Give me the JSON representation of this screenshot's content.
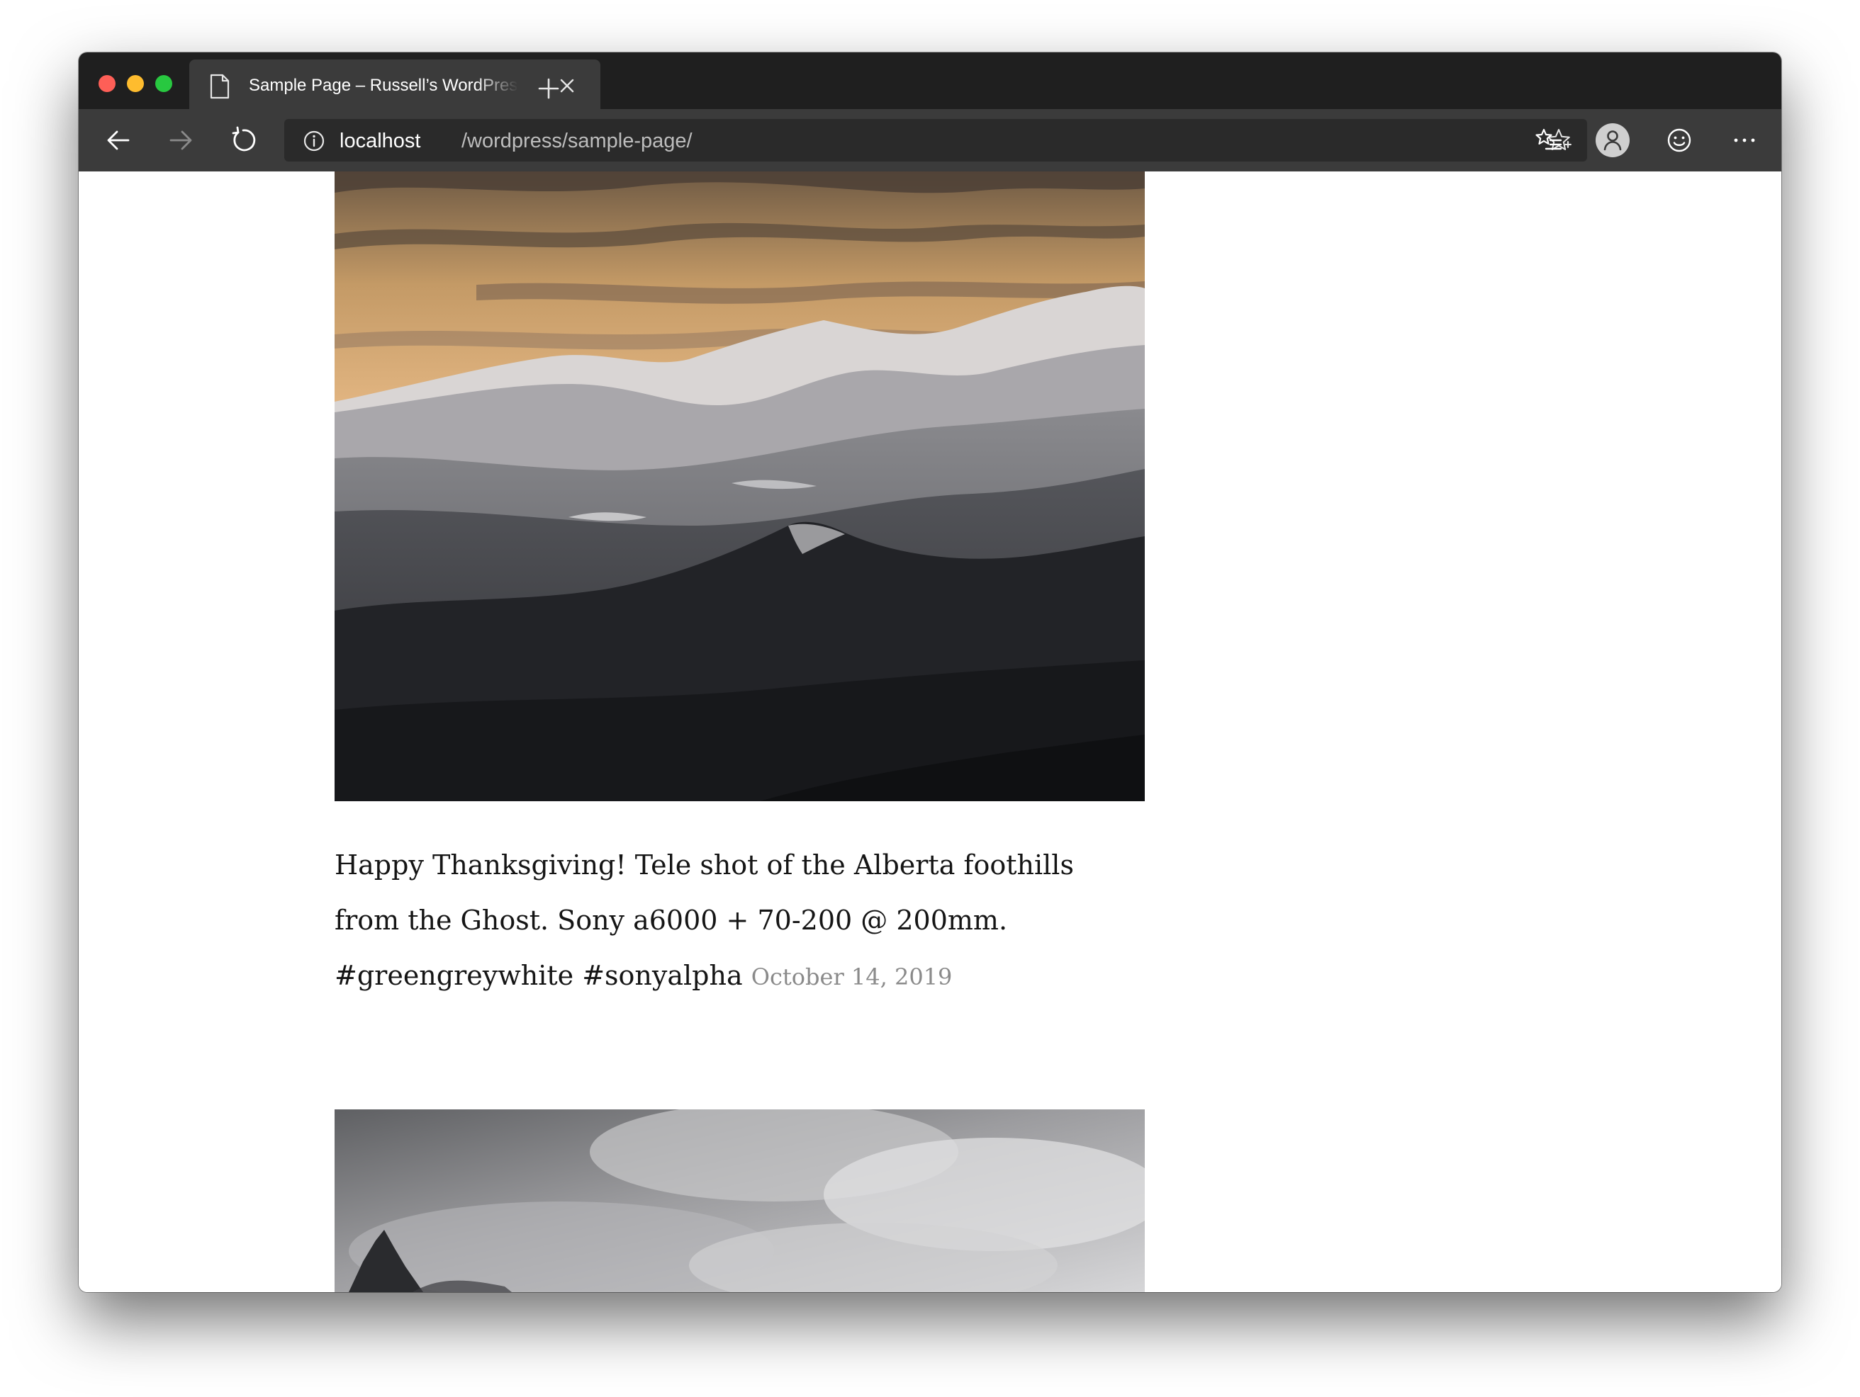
{
  "browser": {
    "tab": {
      "title": "Sample Page – Russell’s WordPress"
    },
    "address_bar": {
      "host": "localhost",
      "path": "/wordpress/sample-page/"
    },
    "icons": {
      "page": "page-icon",
      "close": "close-icon",
      "new_tab": "plus-icon",
      "back": "arrow-left-icon",
      "forward": "arrow-right-icon",
      "reload": "reload-icon",
      "info": "info-icon",
      "favorite": "star-icon",
      "favorites": "favorites-icon",
      "profile": "profile-icon",
      "feedback": "smiley-icon",
      "more": "ellipsis-icon"
    },
    "colors": {
      "titlebar": "#1f1f1f",
      "toolbar": "#3b3b3b",
      "address_bar": "#2a2a2a",
      "close_dot": "#fe5f57",
      "minimize_dot": "#febc2e",
      "zoom_dot": "#28c840"
    }
  },
  "post": {
    "images": [
      {
        "subject": "mountain-range-sunset-photo"
      },
      {
        "subject": "cloudy-mountain-peak-photo"
      }
    ],
    "caption": "Happy Thanksgiving! Tele shot of the Alberta foothills from the Ghost. Sony a6000 + 70-200 @ 200mm. #greengreywhite #sonyalpha",
    "date": "October 14, 2019"
  }
}
